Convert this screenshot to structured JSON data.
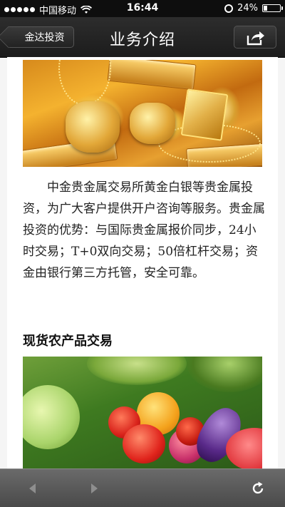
{
  "status_bar": {
    "carrier": "中国移动",
    "time": "16:44",
    "battery_text": "24%",
    "battery_level": 0.24
  },
  "nav": {
    "back_label": "金达投资",
    "title": "业务介绍",
    "share_icon": "share-icon"
  },
  "content": {
    "gold_image_icon": "gold-jewelry-image",
    "description": "中金贵金属交易所黄金白银等贵金属投资，为广大客户提供开户咨询等服务。贵金属投资的优势：与国际贵金属报价同步，24小时交易；T+0双向交易；50倍杠杆交易；资金由银行第三方托管，安全可靠。",
    "section_title": "现货农产品交易",
    "vegetables_image_icon": "vegetables-image"
  },
  "toolbar": {
    "back_icon": "back-arrow-icon",
    "forward_icon": "forward-arrow-icon",
    "refresh_icon": "refresh-icon"
  },
  "colors": {
    "nav_bg": "#1c1c1c",
    "toolbar_bg": "#5a5a5a",
    "page_bg": "#ffffff"
  }
}
